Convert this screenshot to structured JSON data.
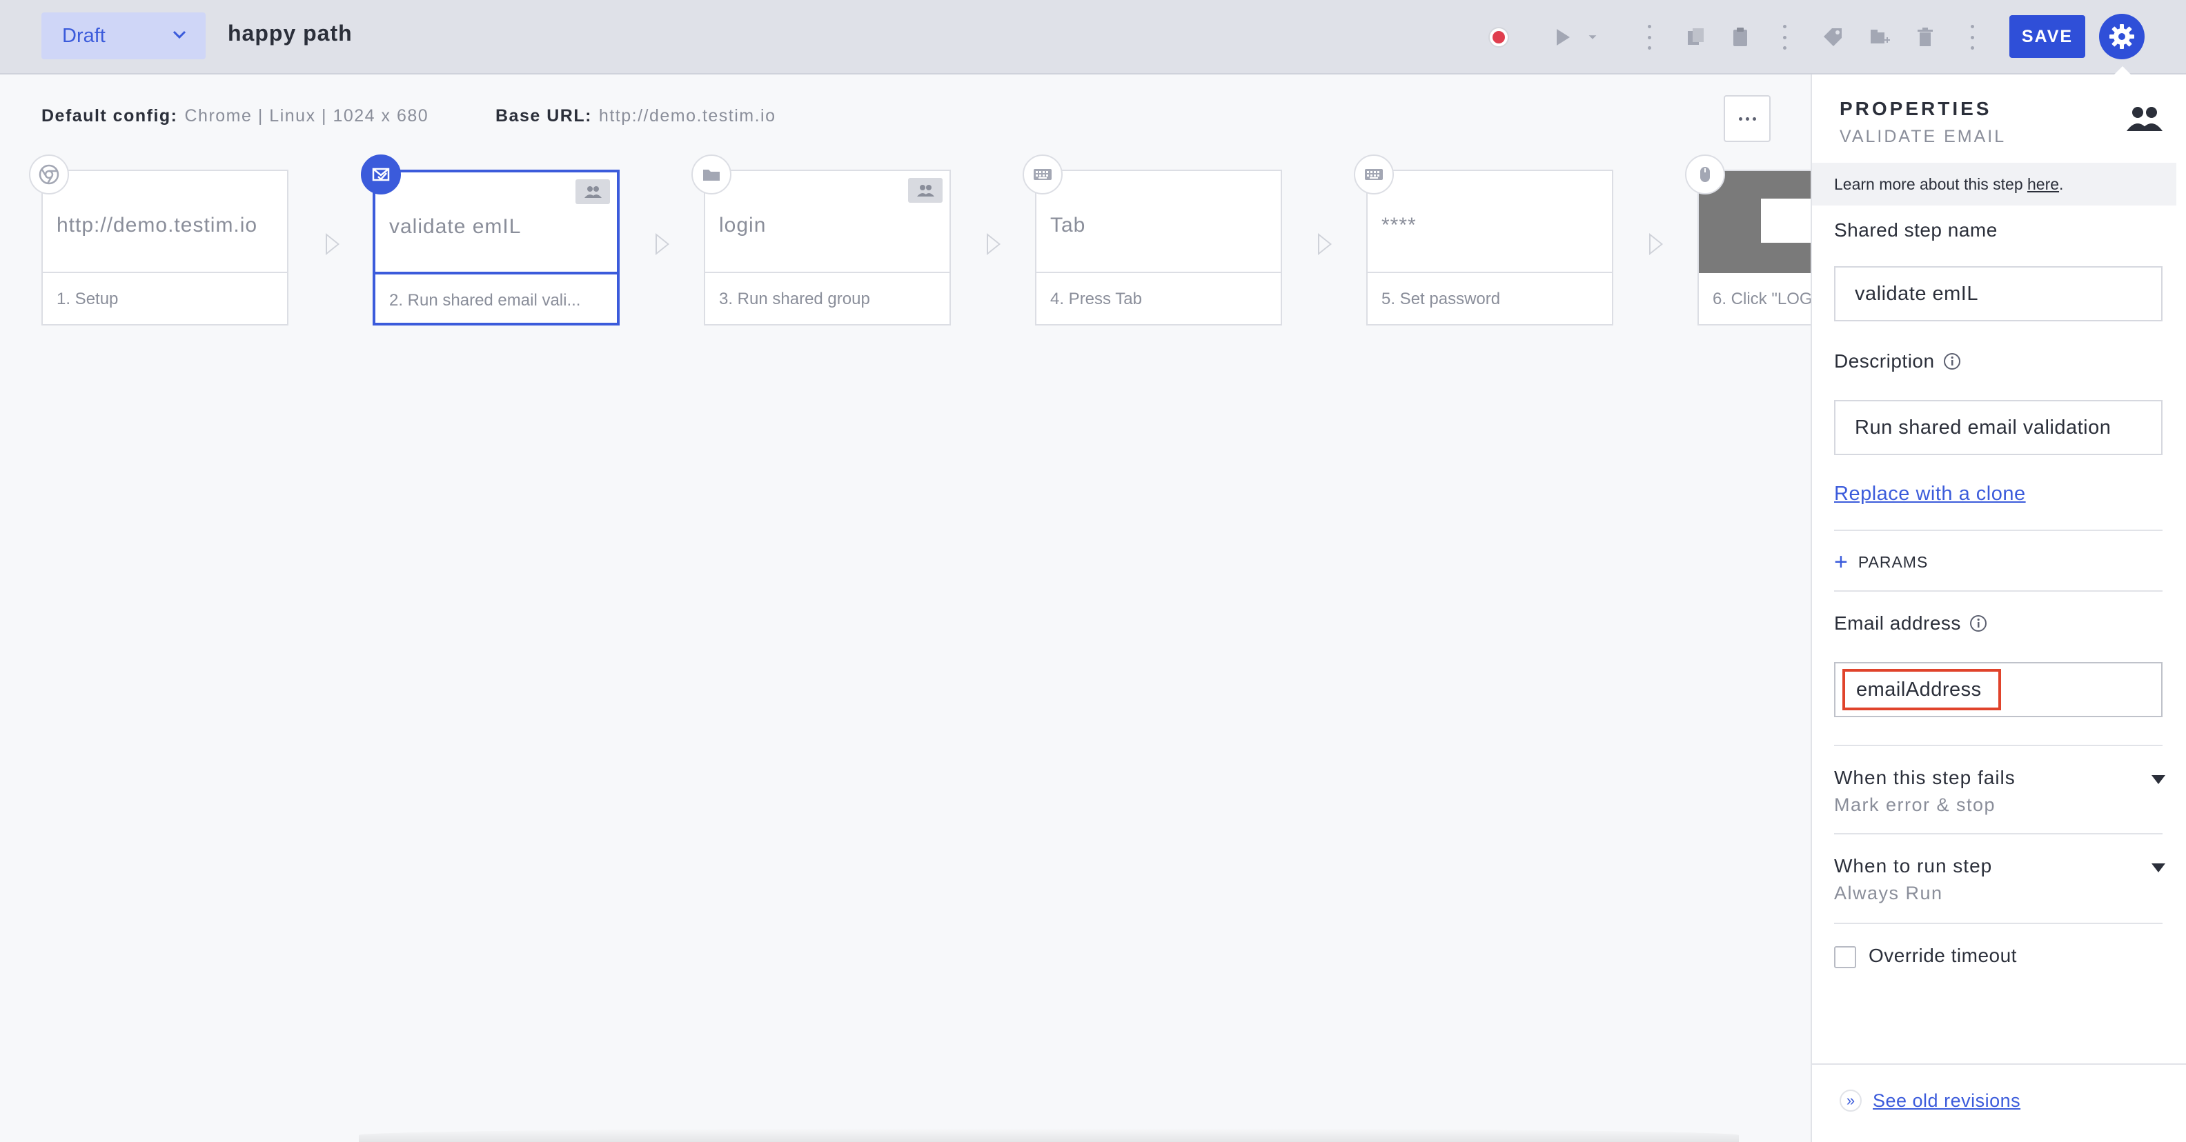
{
  "topbar": {
    "status": "Draft",
    "test_name": "happy path",
    "save_label": "SAVE"
  },
  "config": {
    "default_config_label": "Default config:",
    "default_config_value": "Chrome | Linux | 1024 x 680",
    "base_url_label": "Base URL:",
    "base_url_value": "http://demo.testim.io"
  },
  "steps": [
    {
      "title": "http://demo.testim.io",
      "caption": "1. Setup",
      "icon": "chrome-icon"
    },
    {
      "title": "validate emIL",
      "caption": "2. Run shared email vali...",
      "icon": "email-validate-icon",
      "selected": true
    },
    {
      "title": "login",
      "caption": "3. Run shared group",
      "icon": "folder-icon"
    },
    {
      "title": "Tab",
      "caption": "4. Press Tab",
      "icon": "keyboard-icon"
    },
    {
      "title": "****",
      "caption": "5. Set password",
      "icon": "keyboard-icon"
    },
    {
      "title": "",
      "caption": "6. Click \"LOG",
      "icon": "mouse-icon"
    }
  ],
  "properties": {
    "title": "PROPERTIES",
    "subtitle": "VALIDATE EMAIL",
    "learn_text": "Learn more about this step ",
    "learn_link": "here",
    "learn_period": ".",
    "shared_step_name_label": "Shared step name",
    "shared_step_name_value": "validate emIL",
    "description_label": "Description",
    "description_value": "Run shared email validation",
    "replace_link": "Replace with a clone",
    "params_label": "PARAMS",
    "email_label": "Email address",
    "email_value": "emailAddress",
    "fails_label": "When this step fails",
    "fails_value": "Mark error & stop",
    "run_label": "When to run step",
    "run_value": "Always Run",
    "override_label": "Override timeout",
    "revisions_link": "See old revisions"
  },
  "colors": {
    "accent": "#3b5bdb",
    "save_bg": "#2f4fd8",
    "highlight_border": "#e0432b",
    "record": "#e03e4e"
  }
}
